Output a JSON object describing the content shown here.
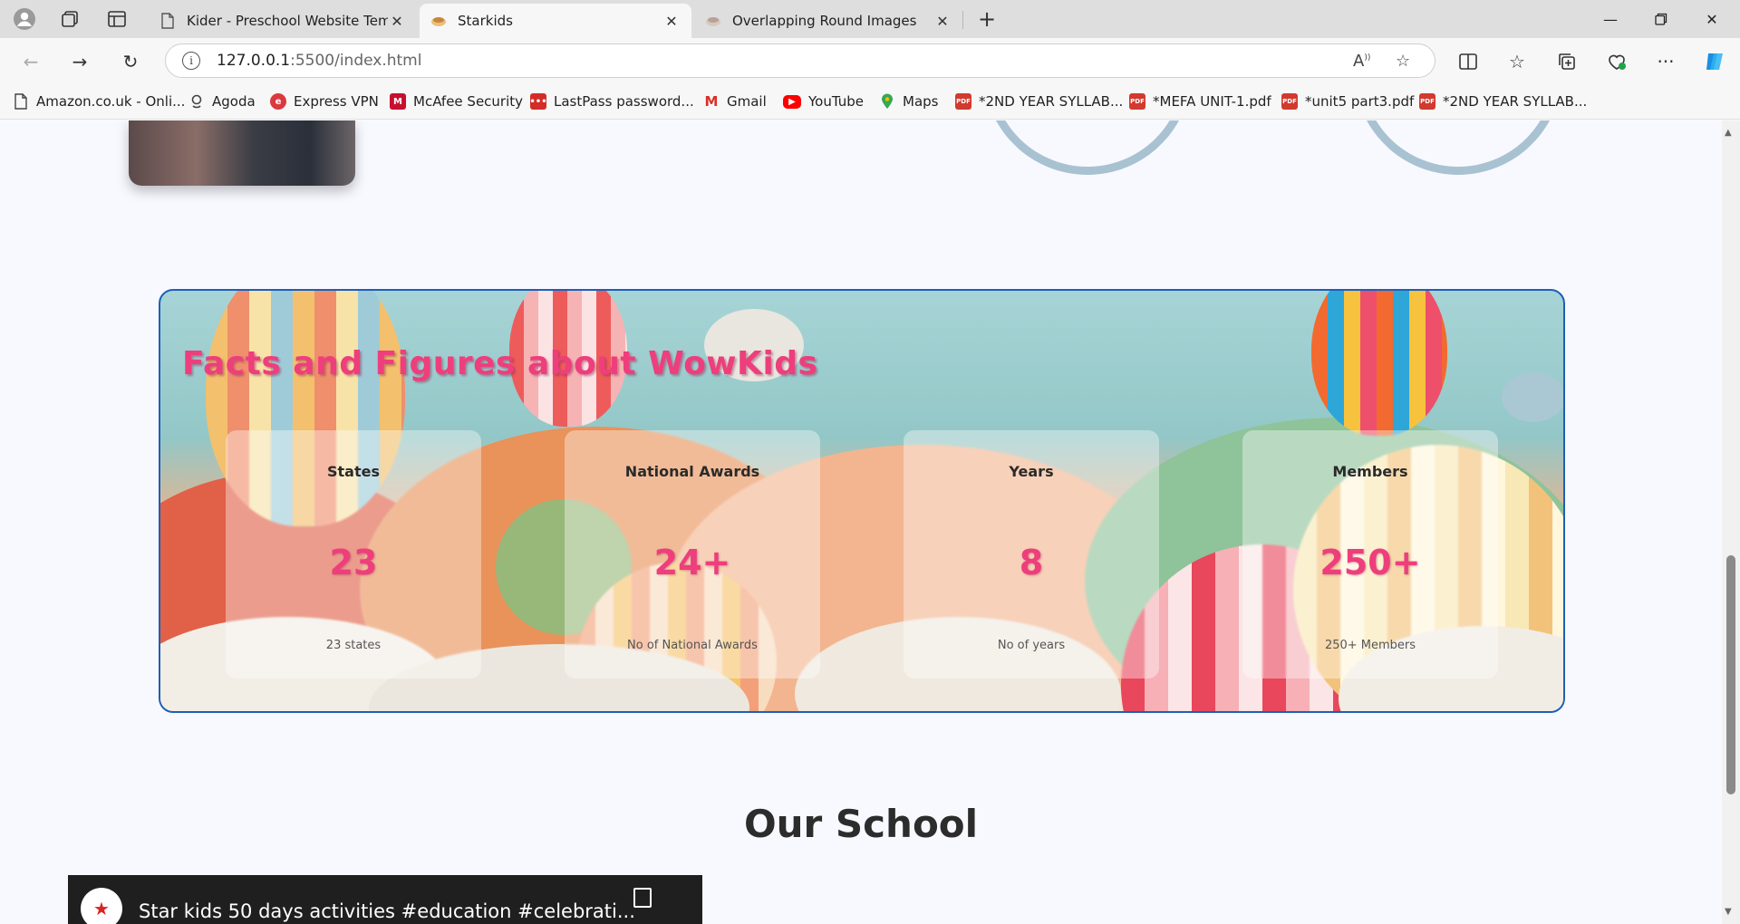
{
  "browser": {
    "tabs": [
      {
        "title": "Kider - Preschool Website Templa",
        "active": false
      },
      {
        "title": "Starkids",
        "active": true
      },
      {
        "title": "Overlapping Round Images",
        "active": false
      }
    ],
    "url_host": "127.0.0.1",
    "url_rest": ":5500/index.html",
    "bookmarks": [
      "Amazon.co.uk - Onli...",
      "Agoda",
      "Express VPN",
      "McAfee Security",
      "LastPass password...",
      "Gmail",
      "YouTube",
      "Maps",
      "*2ND YEAR SYLLAB...",
      "*MEFA UNIT-1.pdf",
      "*unit5 part3.pdf",
      "*2ND YEAR SYLLAB..."
    ]
  },
  "facts": {
    "title": "Facts and Figures about WowKids",
    "cards": [
      {
        "label": "States",
        "value": "23",
        "desc": "23 states"
      },
      {
        "label": "National Awards",
        "value": "24+",
        "desc": "No of National Awards"
      },
      {
        "label": "Years",
        "value": "8",
        "desc": "No of years"
      },
      {
        "label": "Members",
        "value": "250+",
        "desc": "250+ Members"
      }
    ]
  },
  "school": {
    "title": "Our School",
    "video_title": "Star kids 50 days activities #education #celebrati..."
  },
  "colors": {
    "accent_pink": "#ee3e7c",
    "border_blue": "#1d5fb8"
  }
}
